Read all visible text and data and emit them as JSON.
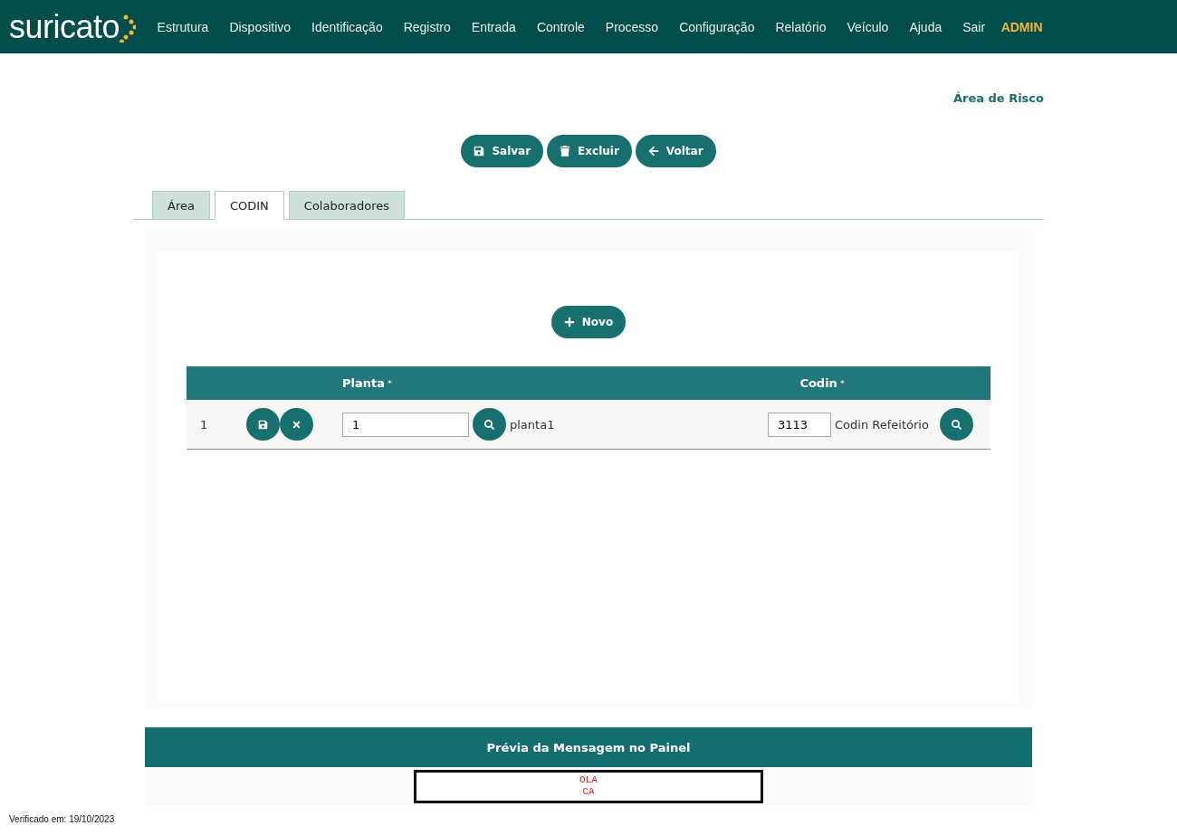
{
  "brand": "suricato",
  "nav": [
    {
      "label": "Estrutura",
      "kind": "link"
    },
    {
      "label": "Dispositivo",
      "kind": "link"
    },
    {
      "label": "Identificação",
      "kind": "link"
    },
    {
      "label": "Registro",
      "kind": "link"
    },
    {
      "label": "Entrada",
      "kind": "link"
    },
    {
      "label": "Controle",
      "kind": "link"
    },
    {
      "label": "Processo",
      "kind": "link"
    },
    {
      "label": "Configuração",
      "kind": "link"
    },
    {
      "label": "Relatório",
      "kind": "link"
    },
    {
      "label": "Veículo",
      "kind": "link"
    },
    {
      "label": "Ajuda",
      "kind": "link"
    },
    {
      "label": "Sair",
      "kind": "link"
    },
    {
      "label": "ADMIN",
      "kind": "user"
    }
  ],
  "page_title": "Área de Risco",
  "actions": [
    {
      "label": "Salvar"
    },
    {
      "label": "Excluir"
    },
    {
      "label": "Voltar"
    }
  ],
  "tabs": [
    {
      "label": "Área",
      "selected": false
    },
    {
      "label": "CODIN",
      "selected": true
    },
    {
      "label": "Colaboradores",
      "selected": false
    }
  ],
  "new_button": "Novo",
  "table": {
    "columns": [
      {
        "label": "Planta",
        "mark": "*"
      },
      {
        "label": "Codin",
        "mark": "*"
      }
    ],
    "rows": [
      {
        "index": "1",
        "planta": "1",
        "planta_name": "planta1",
        "codin": "3113",
        "codin_name": "Codin Refeitório"
      }
    ]
  },
  "preview": {
    "title": "Prévia da Mensagem no Painel",
    "lines": [
      "OLA",
      "CA"
    ]
  },
  "footer": "Verificado em: 19/10/2023"
}
